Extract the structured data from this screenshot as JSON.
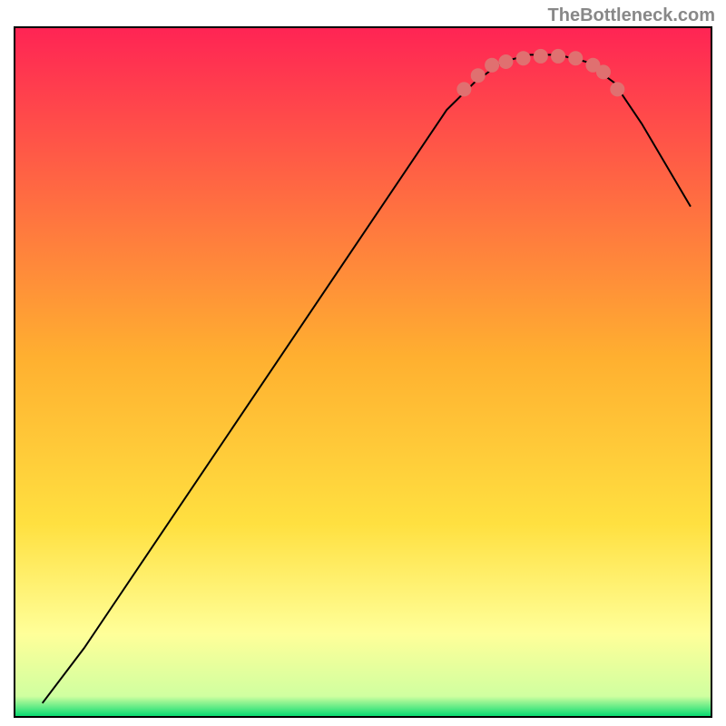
{
  "watermark": "TheBottleneck.com",
  "chart_data": {
    "type": "line",
    "title": "",
    "xlabel": "",
    "ylabel": "",
    "xlim": [
      0,
      100
    ],
    "ylim": [
      0,
      100
    ],
    "curve_points": [
      {
        "x": 4,
        "y": 2
      },
      {
        "x": 10,
        "y": 10
      },
      {
        "x": 62,
        "y": 88
      },
      {
        "x": 66,
        "y": 92
      },
      {
        "x": 70,
        "y": 95
      },
      {
        "x": 74,
        "y": 96
      },
      {
        "x": 78,
        "y": 96
      },
      {
        "x": 82,
        "y": 95
      },
      {
        "x": 86,
        "y": 92
      },
      {
        "x": 90,
        "y": 86
      },
      {
        "x": 97,
        "y": 74
      }
    ],
    "highlight_points": [
      {
        "x": 64.5,
        "y": 91
      },
      {
        "x": 66.5,
        "y": 93
      },
      {
        "x": 68.5,
        "y": 94.5
      },
      {
        "x": 70.5,
        "y": 95
      },
      {
        "x": 73,
        "y": 95.5
      },
      {
        "x": 75.5,
        "y": 95.8
      },
      {
        "x": 78,
        "y": 95.8
      },
      {
        "x": 80.5,
        "y": 95.5
      },
      {
        "x": 83,
        "y": 94.5
      },
      {
        "x": 84.5,
        "y": 93.5
      },
      {
        "x": 86.5,
        "y": 91
      }
    ],
    "gradient_top_color": "#ff2454",
    "gradient_mid_color": "#ffd700",
    "gradient_lower_color": "#ffff99",
    "gradient_bottom_color": "#00d96f",
    "background_color": "#ffffff",
    "highlight_color": "#e07070",
    "curve_color": "#000000"
  }
}
